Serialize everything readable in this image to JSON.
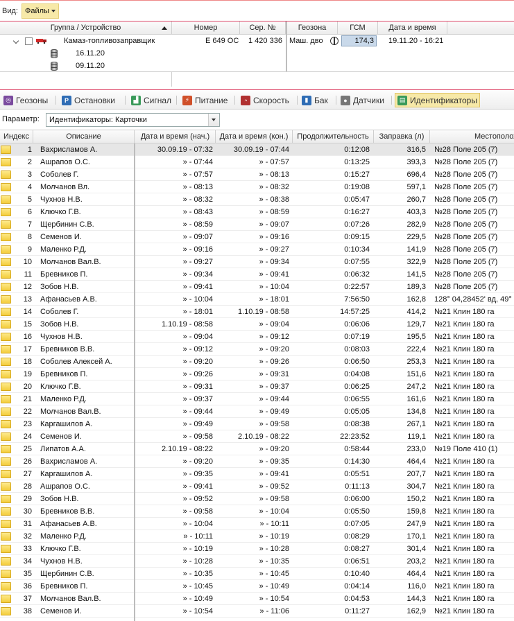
{
  "toolbar": {
    "view_label": "Вид:",
    "files_label": "Файлы"
  },
  "top_grid": {
    "columns": [
      "Группа / Устройство",
      "Номер",
      "Сер. №",
      "Геозона",
      "ГСМ",
      "Дата и время"
    ],
    "device": {
      "name": "Камаз-топливозаправщик",
      "number": "Е 649 ОС",
      "serial": "1 420 336",
      "geozone": "Маш. дво",
      "gsm": "174,3",
      "datetime": "19.11.20 - 16:21"
    },
    "children": [
      {
        "date": "16.11.20"
      },
      {
        "date": "09.11.20"
      }
    ]
  },
  "tabs": [
    {
      "label": "Геозоны",
      "icon": "geozone-icon",
      "color": "#7a4a9e"
    },
    {
      "label": "Остановки",
      "icon": "parking-icon",
      "color": "#2f6db5"
    },
    {
      "label": "Сигнал",
      "icon": "signal-icon",
      "color": "#3a9a5a"
    },
    {
      "label": "Питание",
      "icon": "power-icon",
      "color": "#d0502a"
    },
    {
      "label": "Скорость",
      "icon": "speed-icon",
      "color": "#b03030"
    },
    {
      "label": "Бак",
      "icon": "tank-icon",
      "color": "#2f6db5"
    },
    {
      "label": "Датчики",
      "icon": "sensor-icon",
      "color": "#777777"
    },
    {
      "label": "Идентификаторы",
      "icon": "id-card-icon",
      "color": "#3a9a5a"
    }
  ],
  "param": {
    "label": "Параметр:",
    "value": "Идентификаторы: Карточки"
  },
  "grid": {
    "columns": [
      "Индекс",
      "Описание",
      "Дата и время (нач.)",
      "Дата и время (кон.)",
      "Продолжительность",
      "Заправка (л)",
      "Местоположение"
    ],
    "rows": [
      [
        "1",
        "Вахрисламов А.",
        "30.09.19 - 07:32",
        "30.09.19 - 07:44",
        "0:12:08",
        "316,5",
        "№28 Поле 205 (7)"
      ],
      [
        "2",
        "Ашрапов О.С.",
        "» - 07:44",
        "» - 07:57",
        "0:13:25",
        "393,3",
        "№28 Поле 205 (7)"
      ],
      [
        "3",
        "Соболев Г.",
        "» - 07:57",
        "» - 08:13",
        "0:15:27",
        "696,4",
        "№28 Поле 205 (7)"
      ],
      [
        "4",
        "Молчанов Вл.",
        "» - 08:13",
        "» - 08:32",
        "0:19:08",
        "597,1",
        "№28 Поле 205 (7)"
      ],
      [
        "5",
        "Чухнов Н.В.",
        "» - 08:32",
        "» - 08:38",
        "0:05:47",
        "260,7",
        "№28 Поле 205 (7)"
      ],
      [
        "6",
        "Ключко Г.В.",
        "» - 08:43",
        "» - 08:59",
        "0:16:27",
        "403,3",
        "№28 Поле 205 (7)"
      ],
      [
        "7",
        "Щербинин С.В.",
        "» - 08:59",
        "» - 09:07",
        "0:07:26",
        "282,9",
        "№28 Поле 205 (7)"
      ],
      [
        "8",
        "Семенов И.",
        "» - 09:07",
        "» - 09:16",
        "0:09:15",
        "229,5",
        "№28 Поле 205 (7)"
      ],
      [
        "9",
        "Маленко Р.Д.",
        "» - 09:16",
        "» - 09:27",
        "0:10:34",
        "141,9",
        "№28 Поле 205 (7)"
      ],
      [
        "10",
        "Молчанов Вал.В.",
        "» - 09:27",
        "» - 09:34",
        "0:07:55",
        "322,9",
        "№28 Поле 205 (7)"
      ],
      [
        "11",
        "Бревников П.",
        "» - 09:34",
        "» - 09:41",
        "0:06:32",
        "141,5",
        "№28 Поле 205 (7)"
      ],
      [
        "12",
        "Зобов Н.В.",
        "» - 09:41",
        "» - 10:04",
        "0:22:57",
        "189,3",
        "№28 Поле 205 (7)"
      ],
      [
        "13",
        "Афанасьев А.В.",
        "» - 10:04",
        "» - 18:01",
        "7:56:50",
        "162,8",
        "128° 04,28452' вд, 49°"
      ],
      [
        "14",
        "Соболев Г.",
        "» - 18:01",
        "1.10.19 - 08:58",
        "14:57:25",
        "414,2",
        "№21 Клин 180 га"
      ],
      [
        "15",
        "Зобов Н.В.",
        "1.10.19 - 08:58",
        "» - 09:04",
        "0:06:06",
        "129,7",
        "№21 Клин 180 га"
      ],
      [
        "16",
        "Чухнов Н.В.",
        "» - 09:04",
        "» - 09:12",
        "0:07:19",
        "195,5",
        "№21 Клин 180 га"
      ],
      [
        "17",
        "Бревников В.В.",
        "» - 09:12",
        "» - 09:20",
        "0:08:03",
        "222,4",
        "№21 Клин 180 га"
      ],
      [
        "18",
        "Соболев Алексей А.",
        "» - 09:20",
        "» - 09:26",
        "0:06:50",
        "253,3",
        "№21 Клин 180 га"
      ],
      [
        "19",
        "Бревников П.",
        "» - 09:26",
        "» - 09:31",
        "0:04:08",
        "151,6",
        "№21 Клин 180 га"
      ],
      [
        "20",
        "Ключко Г.В.",
        "» - 09:31",
        "» - 09:37",
        "0:06:25",
        "247,2",
        "№21 Клин 180 га"
      ],
      [
        "21",
        "Маленко Р.Д.",
        "» - 09:37",
        "» - 09:44",
        "0:06:55",
        "161,6",
        "№21 Клин 180 га"
      ],
      [
        "22",
        "Молчанов Вал.В.",
        "» - 09:44",
        "» - 09:49",
        "0:05:05",
        "134,8",
        "№21 Клин 180 га"
      ],
      [
        "23",
        "Каргашилов А.",
        "» - 09:49",
        "» - 09:58",
        "0:08:38",
        "267,1",
        "№21 Клин 180 га"
      ],
      [
        "24",
        "Семенов И.",
        "» - 09:58",
        "2.10.19 - 08:22",
        "22:23:52",
        "119,1",
        "№21 Клин 180 га"
      ],
      [
        "25",
        "Липатов А.А.",
        "2.10.19 - 08:22",
        "» - 09:20",
        "0:58:44",
        "233,0",
        "№19 Поле 410 (1)"
      ],
      [
        "26",
        "Вахрисламов А.",
        "» - 09:20",
        "» - 09:35",
        "0:14:30",
        "464,4",
        "№21 Клин 180 га"
      ],
      [
        "27",
        "Каргашилов А.",
        "» - 09:35",
        "» - 09:41",
        "0:05:51",
        "207,7",
        "№21 Клин 180 га"
      ],
      [
        "28",
        "Ашрапов О.С.",
        "» - 09:41",
        "» - 09:52",
        "0:11:13",
        "304,7",
        "№21 Клин 180 га"
      ],
      [
        "29",
        "Зобов Н.В.",
        "» - 09:52",
        "» - 09:58",
        "0:06:00",
        "150,2",
        "№21 Клин 180 га"
      ],
      [
        "30",
        "Бревников В.В.",
        "» - 09:58",
        "» - 10:04",
        "0:05:50",
        "159,8",
        "№21 Клин 180 га"
      ],
      [
        "31",
        "Афанасьев А.В.",
        "» - 10:04",
        "» - 10:11",
        "0:07:05",
        "247,9",
        "№21 Клин 180 га"
      ],
      [
        "32",
        "Маленко Р.Д.",
        "» - 10:11",
        "» - 10:19",
        "0:08:29",
        "170,1",
        "№21 Клин 180 га"
      ],
      [
        "33",
        "Ключко Г.В.",
        "» - 10:19",
        "» - 10:28",
        "0:08:27",
        "301,4",
        "№21 Клин 180 га"
      ],
      [
        "34",
        "Чухнов Н.В.",
        "» - 10:28",
        "» - 10:35",
        "0:06:51",
        "203,2",
        "№21 Клин 180 га"
      ],
      [
        "35",
        "Щербинин С.В.",
        "» - 10:35",
        "» - 10:45",
        "0:10:40",
        "464,4",
        "№21 Клин 180 га"
      ],
      [
        "36",
        "Бревников П.",
        "» - 10:45",
        "» - 10:49",
        "0:04:14",
        "116,0",
        "№21 Клин 180 га"
      ],
      [
        "37",
        "Молчанов Вал.В.",
        "» - 10:49",
        "» - 10:54",
        "0:04:53",
        "144,3",
        "№21 Клин 180 га"
      ],
      [
        "38",
        "Семенов И.",
        "» - 10:54",
        "» - 11:06",
        "0:11:27",
        "162,9",
        "№21 Клин 180 га"
      ]
    ]
  }
}
